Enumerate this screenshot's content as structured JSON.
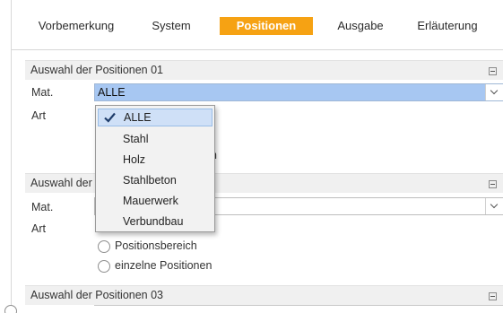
{
  "tabs": [
    {
      "label": "Vorbemerkung"
    },
    {
      "label": "System"
    },
    {
      "label": "Positionen"
    },
    {
      "label": "Ausgabe"
    },
    {
      "label": "Erläuterung"
    }
  ],
  "active_tab": "Positionen",
  "accent_color": "#f6a213",
  "sections": [
    {
      "title": "Auswahl der Positionen 01",
      "mat_label": "Mat.",
      "art_label": "Art",
      "mat_value": "ALLE",
      "partial_radio_text": "n"
    },
    {
      "title": "Auswahl der",
      "mat_label": "Mat.",
      "art_label": "Art",
      "radio_options": [
        "Positionsbereich",
        "einzelne Positionen"
      ]
    },
    {
      "title": "Auswahl der Positionen 03"
    }
  ],
  "dropdown": {
    "selected": "ALLE",
    "options": [
      "ALLE",
      "Stahl",
      "Holz",
      "Stahlbeton",
      "Mauerwerk",
      "Verbundbau"
    ]
  }
}
